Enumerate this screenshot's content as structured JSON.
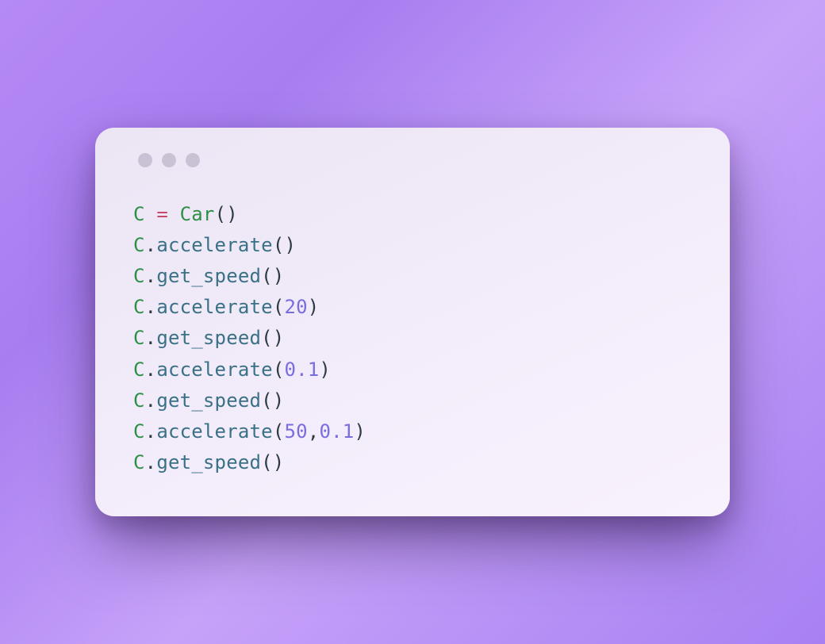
{
  "code": {
    "lines": [
      [
        {
          "t": "C",
          "c": "tk-id"
        },
        {
          "t": " ",
          "c": "tk-punct"
        },
        {
          "t": "=",
          "c": "tk-op"
        },
        {
          "t": " ",
          "c": "tk-punct"
        },
        {
          "t": "Car",
          "c": "tk-cls"
        },
        {
          "t": "()",
          "c": "tk-punct"
        }
      ],
      [
        {
          "t": "C",
          "c": "tk-id"
        },
        {
          "t": ".",
          "c": "tk-dot"
        },
        {
          "t": "accelerate",
          "c": "tk-method"
        },
        {
          "t": "()",
          "c": "tk-punct"
        }
      ],
      [
        {
          "t": "C",
          "c": "tk-id"
        },
        {
          "t": ".",
          "c": "tk-dot"
        },
        {
          "t": "get_speed",
          "c": "tk-method"
        },
        {
          "t": "()",
          "c": "tk-punct"
        }
      ],
      [
        {
          "t": "C",
          "c": "tk-id"
        },
        {
          "t": ".",
          "c": "tk-dot"
        },
        {
          "t": "accelerate",
          "c": "tk-method"
        },
        {
          "t": "(",
          "c": "tk-punct"
        },
        {
          "t": "20",
          "c": "tk-num"
        },
        {
          "t": ")",
          "c": "tk-punct"
        }
      ],
      [
        {
          "t": "C",
          "c": "tk-id"
        },
        {
          "t": ".",
          "c": "tk-dot"
        },
        {
          "t": "get_speed",
          "c": "tk-method"
        },
        {
          "t": "()",
          "c": "tk-punct"
        }
      ],
      [
        {
          "t": "C",
          "c": "tk-id"
        },
        {
          "t": ".",
          "c": "tk-dot"
        },
        {
          "t": "accelerate",
          "c": "tk-method"
        },
        {
          "t": "(",
          "c": "tk-punct"
        },
        {
          "t": "0.1",
          "c": "tk-num"
        },
        {
          "t": ")",
          "c": "tk-punct"
        }
      ],
      [
        {
          "t": "C",
          "c": "tk-id"
        },
        {
          "t": ".",
          "c": "tk-dot"
        },
        {
          "t": "get_speed",
          "c": "tk-method"
        },
        {
          "t": "()",
          "c": "tk-punct"
        }
      ],
      [
        {
          "t": "C",
          "c": "tk-id"
        },
        {
          "t": ".",
          "c": "tk-dot"
        },
        {
          "t": "accelerate",
          "c": "tk-method"
        },
        {
          "t": "(",
          "c": "tk-punct"
        },
        {
          "t": "50",
          "c": "tk-num"
        },
        {
          "t": ",",
          "c": "tk-punct"
        },
        {
          "t": "0.1",
          "c": "tk-num"
        },
        {
          "t": ")",
          "c": "tk-punct"
        }
      ],
      [
        {
          "t": "C",
          "c": "tk-id"
        },
        {
          "t": ".",
          "c": "tk-dot"
        },
        {
          "t": "get_speed",
          "c": "tk-method"
        },
        {
          "t": "()",
          "c": "tk-punct"
        }
      ]
    ]
  }
}
